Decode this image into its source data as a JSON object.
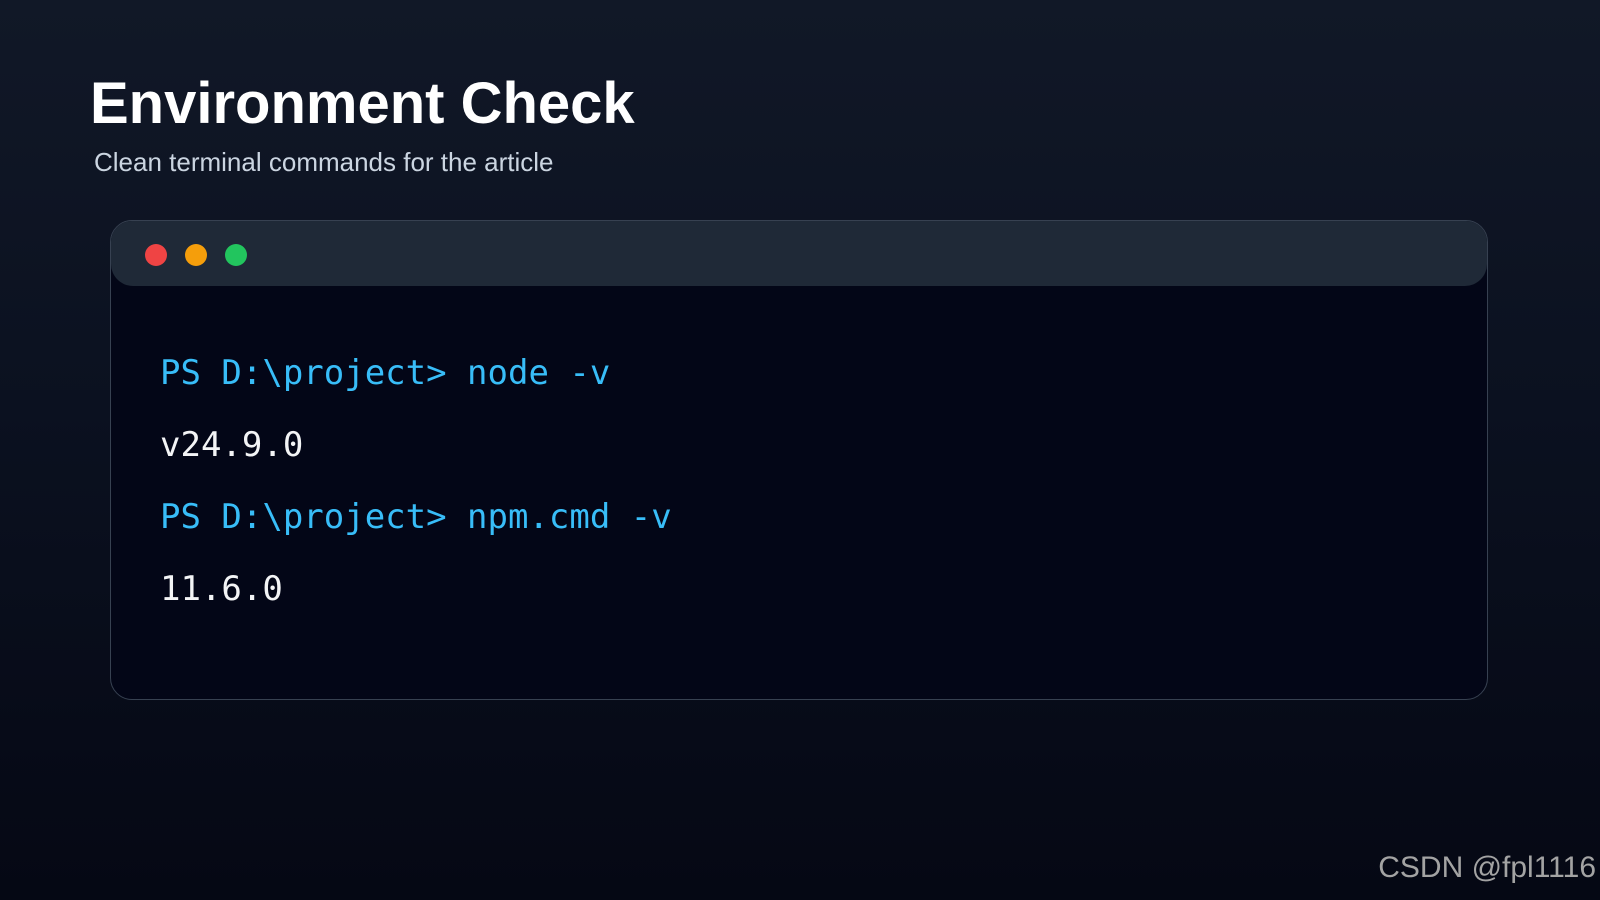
{
  "header": {
    "title": "Environment Check",
    "subtitle": "Clean terminal commands for the article"
  },
  "terminal": {
    "window_controls": {
      "close_color": "#ef4444",
      "minimize_color": "#f59e0b",
      "maximize_color": "#22c55e"
    },
    "lines": [
      {
        "type": "command",
        "text": "PS D:\\project> node -v"
      },
      {
        "type": "output",
        "text": "v24.9.0"
      },
      {
        "type": "command",
        "text": "PS D:\\project> npm.cmd -v"
      },
      {
        "type": "output",
        "text": "11.6.0"
      }
    ],
    "colors": {
      "command": "#38bdf8",
      "output": "#f3f4f6",
      "background": "#030617",
      "titlebar": "#1f2937"
    }
  },
  "watermark": {
    "text": "CSDN @fpl1116"
  }
}
